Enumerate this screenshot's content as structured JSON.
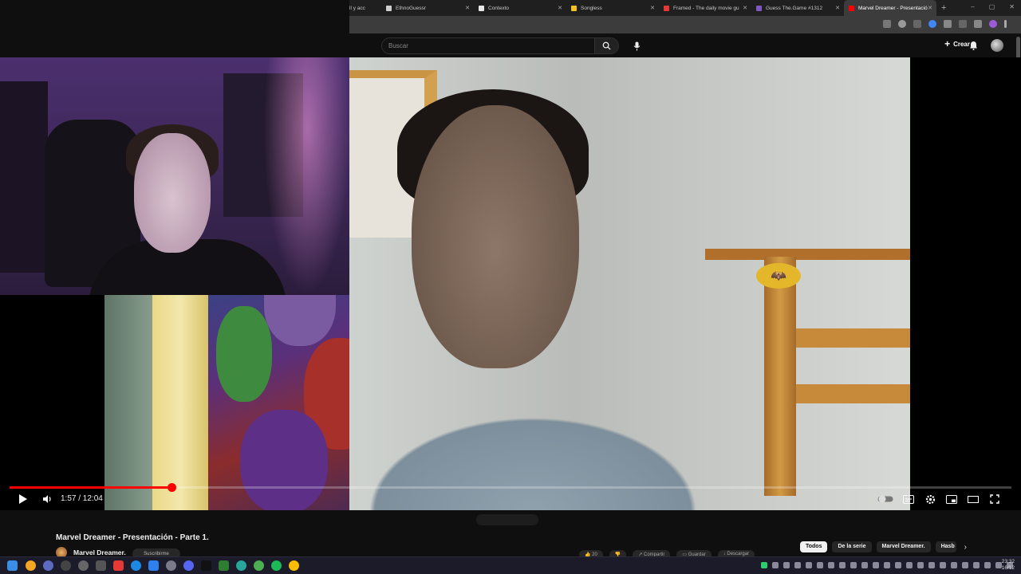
{
  "browser": {
    "tabs": [
      {
        "label": "ll y acc",
        "color": "#8ab4f8"
      },
      {
        "label": "EthnoGuessr",
        "color": "#cfcfcf"
      },
      {
        "label": "Contexto",
        "color": "#e8e8e8"
      },
      {
        "label": "Songless",
        "color": "#f2c21f"
      },
      {
        "label": "Framed - The daily movie gu",
        "color": "#e53935"
      },
      {
        "label": "Guess The.Game #1312",
        "color": "#7e57c2"
      },
      {
        "label": "Marvel Dreamer - Presentació",
        "color": "#ff0000"
      }
    ],
    "new_tab": "+",
    "window_controls": [
      "–",
      "▢",
      "✕"
    ]
  },
  "youtube": {
    "search_placeholder": "Buscar",
    "create_label": "Crear"
  },
  "player": {
    "current_time": "1:57",
    "duration": "12:04",
    "time_display": "1:57 / 12:04",
    "progress": 0.1616
  },
  "video": {
    "title": "Marvel Dreamer - Presentación - Parte 1.",
    "channel": "Marvel Dreamer.",
    "subscribe_label": "Suscribirme",
    "like_count": "20",
    "share_label": "Compartir",
    "save_label": "Guardar",
    "download_label": "Descargar"
  },
  "chips": [
    "Todos",
    "De la serie",
    "Marvel Dreamer.",
    "Hasb"
  ],
  "taskbar": {
    "time": "23:32",
    "date": "16/12"
  },
  "colors": {
    "accent": "#ff0000",
    "background": "#0f0f0f",
    "chip_bg": "#272727"
  }
}
